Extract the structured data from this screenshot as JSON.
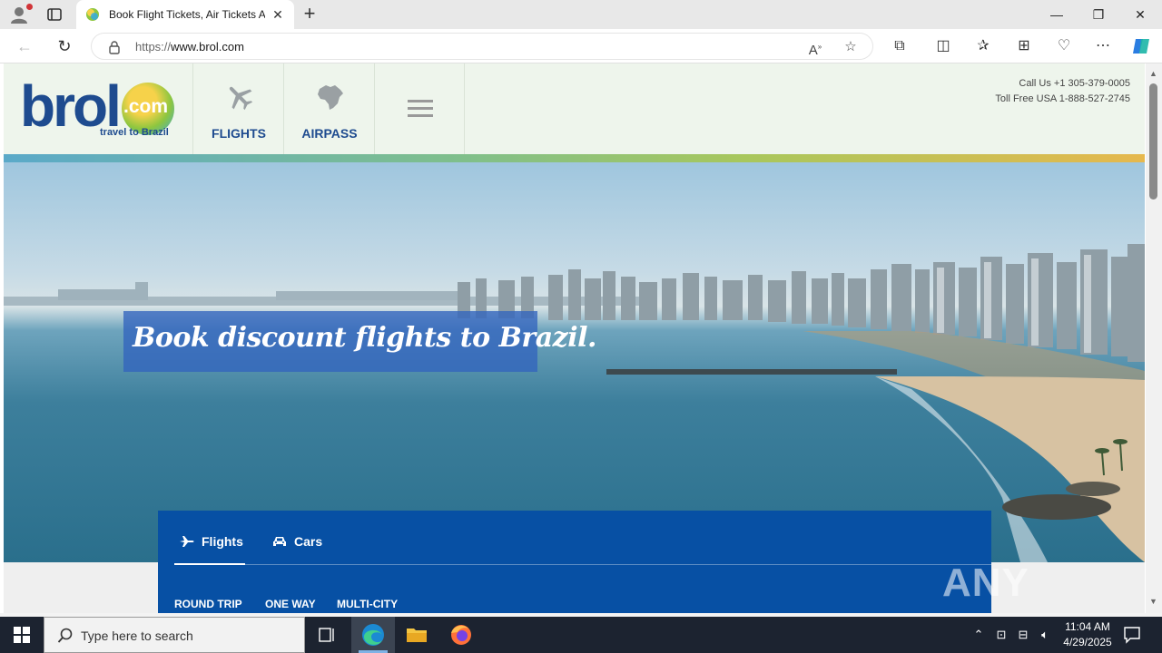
{
  "browser": {
    "tab_title": "Book Flight Tickets, Air Tickets Ai",
    "new_tab_symbol": "+",
    "close_tab_symbol": "✕",
    "url_prefix": "https://",
    "url_host": "www.brol.com",
    "window_controls": {
      "minimize": "—",
      "restore": "❐",
      "close": "✕"
    }
  },
  "site": {
    "logo": {
      "word": "brol",
      "dot_com": ".com",
      "tagline": "travel to Brazil"
    },
    "nav": [
      {
        "label": "FLIGHTS",
        "icon": "plane-icon"
      },
      {
        "label": "AIRPASS",
        "icon": "brazil-map-icon"
      }
    ],
    "contact": {
      "call_us": "Call Us +1 305-379-0005",
      "toll_free": "Toll Free USA 1-888-527-2745"
    },
    "hero": {
      "headline": "Book discount flights to Brazil."
    },
    "search": {
      "tabs": [
        {
          "label": "Flights",
          "icon": "plane-icon",
          "active": true
        },
        {
          "label": "Cars",
          "icon": "car-icon",
          "active": false
        }
      ],
      "trip_types": [
        "ROUND TRIP",
        "ONE WAY",
        "MULTI-CITY"
      ]
    },
    "watermark": "ANY RUN"
  },
  "taskbar": {
    "search_placeholder": "Type here to search",
    "time": "11:04 AM",
    "date": "4/29/2025",
    "apps": [
      "task-view-icon",
      "edge-icon",
      "file-explorer-icon",
      "firefox-icon"
    ]
  },
  "colors": {
    "brand_blue": "#1e4b8f",
    "search_panel": "#0750a4",
    "header_bg": "#eef5ec",
    "taskbar": "#1c2330"
  }
}
